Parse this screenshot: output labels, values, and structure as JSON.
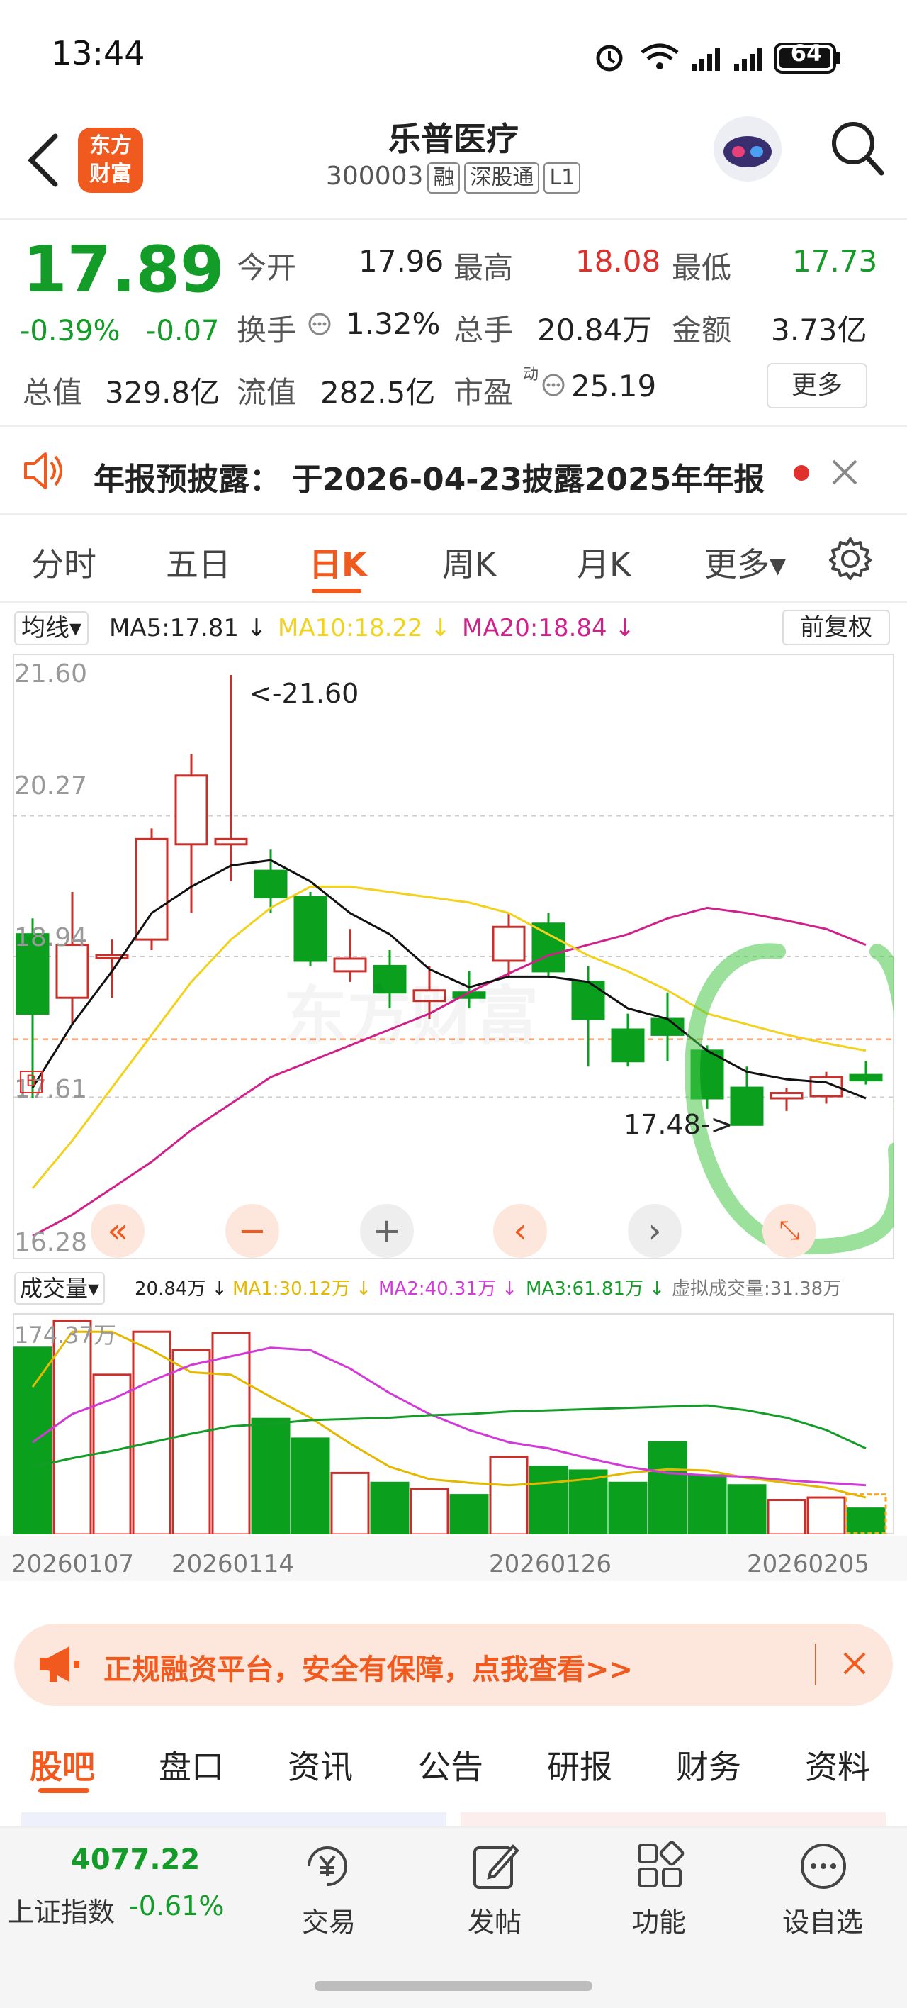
{
  "status_bar": {
    "time": "13:44",
    "battery": "64"
  },
  "header": {
    "logo_text_line1": "东方",
    "logo_text_line2": "财富",
    "title": "乐普医疗",
    "code": "300003",
    "tags": [
      "融",
      "深股通",
      "L1"
    ]
  },
  "quote": {
    "price": "17.89",
    "change_pct": "-0.39%",
    "change": "-0.07",
    "open_label": "今开",
    "open": "17.96",
    "high_label": "最高",
    "high": "18.08",
    "low_label": "最低",
    "low": "17.73",
    "turnover_label": "换手",
    "turnover": "1.32%",
    "volume_label": "总手",
    "volume": "20.84万",
    "amount_label": "金额",
    "amount": "3.73亿",
    "mktcap_label": "总值",
    "mktcap": "329.8亿",
    "float_label": "流值",
    "float": "282.5亿",
    "pe_label": "市盈",
    "pe_sup": "动",
    "pe": "25.19",
    "more_button": "更多"
  },
  "notice": {
    "text": "年报预披露：  于2026-04-23披露2025年年报"
  },
  "tabs": [
    "分时",
    "五日",
    "日K",
    "周K",
    "月K",
    "更多▾"
  ],
  "active_tab_index": 2,
  "ma_bar": {
    "selector": "均线▾",
    "ma5": "MA5:17.81",
    "ma10": "MA10:18.22",
    "ma20": "MA20:18.84",
    "adjust": "前复权",
    "arrow": "↓"
  },
  "kline": {
    "y_labels": [
      "21.60",
      "20.27",
      "18.94",
      "17.61",
      "16.28"
    ],
    "max_annotation": "<-21.60",
    "min_annotation": "17.48->",
    "watermark": "东方财富"
  },
  "volume_bar": {
    "selector": "成交量▾",
    "vol": "20.84万",
    "ma1": "MA1:30.12万",
    "ma2": "MA2:40.31万",
    "ma3": "MA3:61.81万",
    "virtual": "虚拟成交量:31.38万",
    "arrow": "↓",
    "max_label": "174.37万",
    "dates": [
      "20260107",
      "20260114",
      "20260126",
      "20260205"
    ]
  },
  "chart_data": {
    "type": "candlestick",
    "ylim": [
      16.28,
      21.6
    ],
    "candles": [
      {
        "o": 19.15,
        "c": 18.4,
        "h": 19.3,
        "l": 17.6
      },
      {
        "o": 18.55,
        "c": 19.05,
        "h": 19.55,
        "l": 18.3
      },
      {
        "o": 18.95,
        "c": 18.95,
        "h": 19.1,
        "l": 18.55
      },
      {
        "o": 19.1,
        "c": 20.05,
        "h": 20.15,
        "l": 19.0
      },
      {
        "o": 20.0,
        "c": 20.65,
        "h": 20.85,
        "l": 19.35
      },
      {
        "o": 20.0,
        "c": 20.05,
        "h": 21.6,
        "l": 19.65
      },
      {
        "o": 19.75,
        "c": 19.5,
        "h": 19.95,
        "l": 19.35
      },
      {
        "o": 19.5,
        "c": 18.9,
        "h": 19.55,
        "l": 18.85
      },
      {
        "o": 18.8,
        "c": 18.92,
        "h": 19.2,
        "l": 18.7
      },
      {
        "o": 18.85,
        "c": 18.6,
        "h": 19.0,
        "l": 18.45
      },
      {
        "o": 18.52,
        "c": 18.62,
        "h": 18.85,
        "l": 18.35
      },
      {
        "o": 18.6,
        "c": 18.55,
        "h": 18.8,
        "l": 18.45
      },
      {
        "o": 18.9,
        "c": 19.22,
        "h": 19.35,
        "l": 18.75
      },
      {
        "o": 19.25,
        "c": 18.8,
        "h": 19.35,
        "l": 18.75
      },
      {
        "o": 18.7,
        "c": 18.35,
        "h": 18.85,
        "l": 17.9
      },
      {
        "o": 18.25,
        "c": 17.95,
        "h": 18.4,
        "l": 17.9
      },
      {
        "o": 18.35,
        "c": 18.2,
        "h": 18.6,
        "l": 17.95
      },
      {
        "o": 18.05,
        "c": 17.6,
        "h": 18.1,
        "l": 17.5
      },
      {
        "o": 17.7,
        "c": 17.35,
        "h": 17.9,
        "l": 17.35
      },
      {
        "o": 17.6,
        "c": 17.65,
        "h": 17.7,
        "l": 17.48
      },
      {
        "o": 17.62,
        "c": 17.8,
        "h": 17.85,
        "l": 17.55
      },
      {
        "o": 17.82,
        "c": 17.77,
        "h": 17.95,
        "l": 17.73
      }
    ],
    "ma5": [
      17.7,
      18.3,
      18.8,
      19.35,
      19.6,
      19.8,
      19.85,
      19.65,
      19.35,
      19.15,
      18.82,
      18.65,
      18.75,
      18.75,
      18.7,
      18.45,
      18.35,
      18.05,
      17.85,
      17.78,
      17.75,
      17.6
    ],
    "ma10": [
      16.75,
      17.2,
      17.7,
      18.2,
      18.7,
      19.1,
      19.4,
      19.6,
      19.6,
      19.55,
      19.5,
      19.45,
      19.35,
      19.15,
      18.95,
      18.8,
      18.62,
      18.4,
      18.3,
      18.2,
      18.12,
      18.05
    ],
    "ma20": [
      16.3,
      16.5,
      16.75,
      17.0,
      17.3,
      17.55,
      17.8,
      17.95,
      18.1,
      18.25,
      18.4,
      18.6,
      18.78,
      18.95,
      19.05,
      19.15,
      19.3,
      19.4,
      19.35,
      19.28,
      19.2,
      19.05
    ],
    "volume": [
      152,
      174,
      130,
      165,
      150,
      164,
      94,
      78,
      50,
      42,
      37,
      32,
      63,
      55,
      52,
      42,
      75,
      48,
      40,
      28,
      30,
      21
    ],
    "vol_ma1": [
      120,
      165,
      165,
      150,
      132,
      130,
      112,
      95,
      74,
      55,
      45,
      42,
      40,
      42,
      45,
      50,
      53,
      52,
      46,
      42,
      38,
      30
    ],
    "vol_ma2": [
      75,
      98,
      110,
      125,
      138,
      145,
      152,
      150,
      135,
      115,
      98,
      85,
      75,
      70,
      62,
      55,
      50,
      48,
      47,
      44,
      42,
      40
    ],
    "vol_ma3": [
      55,
      62,
      68,
      75,
      82,
      88,
      90,
      93,
      94,
      95,
      97,
      98,
      100,
      101,
      102,
      103,
      104,
      105,
      101,
      95,
      85,
      70
    ],
    "vol_max": 174.37
  },
  "promo": {
    "text": "正规融资平台，安全有保障，点我查看>>"
  },
  "bottom_tabs": [
    "股吧",
    "盘口",
    "资讯",
    "公告",
    "研报",
    "财务",
    "资料"
  ],
  "bottom_nav": {
    "index_value": "4077.22",
    "index_name": "上证指数",
    "index_change": "-0.61%",
    "items": [
      "交易",
      "发帖",
      "功能",
      "设自选"
    ]
  }
}
